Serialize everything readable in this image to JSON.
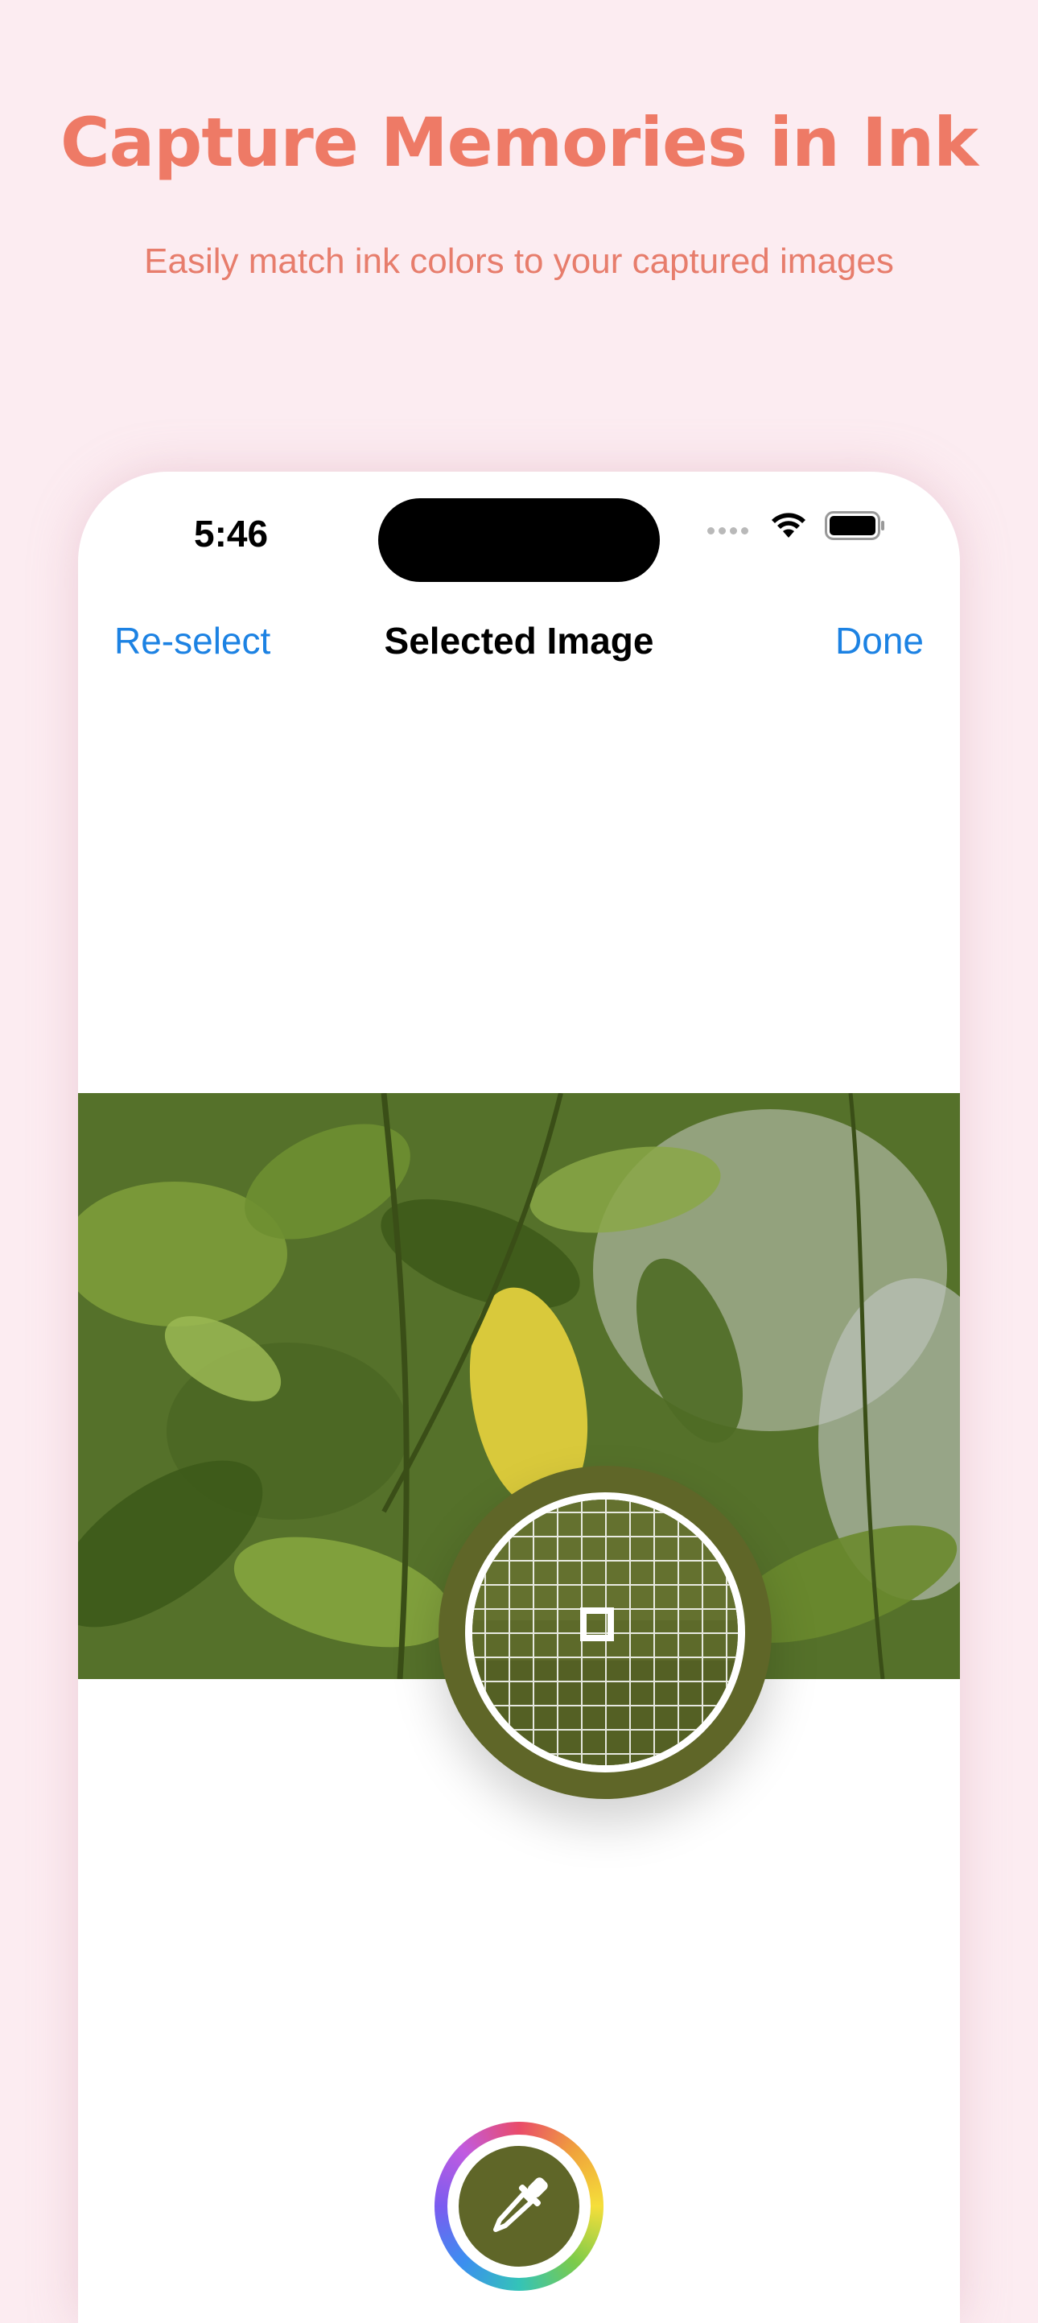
{
  "promo": {
    "title": "Capture Memories in Ink",
    "subtitle": "Easily match ink colors to your captured images"
  },
  "status_bar": {
    "time": "5:46",
    "icons": [
      "cellular-signal-icon",
      "wifi-icon",
      "battery-icon"
    ]
  },
  "nav": {
    "left_label": "Re-select",
    "title": "Selected Image",
    "right_label": "Done"
  },
  "colors": {
    "background": "#fcecf1",
    "promo_text": "#ee7a66",
    "accent": "#1c82e3",
    "sampled_color": "#5f6628"
  },
  "picker": {
    "icon": "eyedropper-icon"
  }
}
